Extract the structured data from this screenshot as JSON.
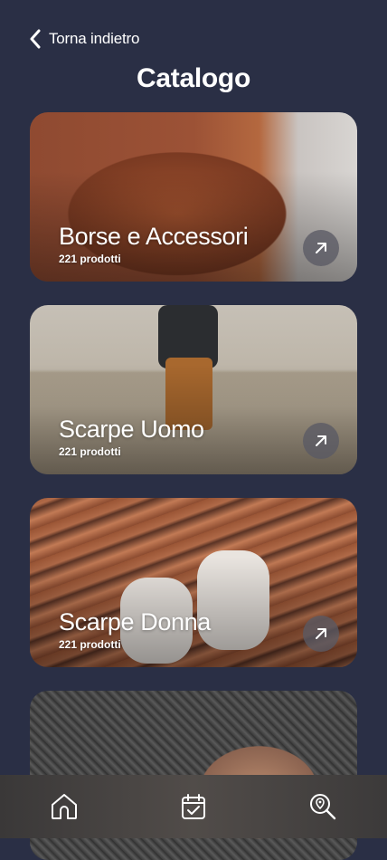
{
  "header": {
    "back_label": "Torna indietro",
    "title": "Catalogo"
  },
  "categories": [
    {
      "name": "Borse e Accessori",
      "count": "221 prodotti"
    },
    {
      "name": "Scarpe Uomo",
      "count": "221 prodotti"
    },
    {
      "name": "Scarpe Donna",
      "count": "221 prodotti"
    },
    {
      "name": "",
      "count": ""
    }
  ],
  "bottom_nav": {
    "icons": [
      "home-icon",
      "calendar-check-icon",
      "search-location-icon"
    ]
  },
  "colors": {
    "background": "#2a2f45",
    "text": "#ffffff",
    "arrow_button": "#5a5a64"
  }
}
